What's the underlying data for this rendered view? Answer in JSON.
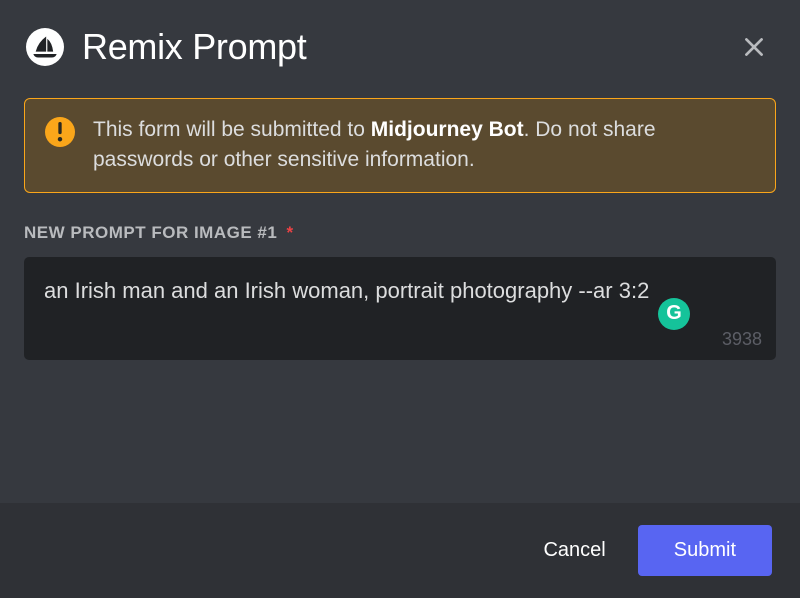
{
  "header": {
    "title": "Remix Prompt"
  },
  "warning": {
    "text_prefix": "This form will be submitted to ",
    "bot_name": "Midjourney Bot",
    "text_suffix": ". Do not share passwords or other sensitive information."
  },
  "field": {
    "label": "NEW PROMPT FOR IMAGE #1",
    "required_mark": "*",
    "value": "an Irish man and an Irish woman, portrait photography --ar 3:2",
    "char_counter": "3938"
  },
  "grammarly": {
    "glyph": "G"
  },
  "footer": {
    "cancel_label": "Cancel",
    "submit_label": "Submit"
  }
}
